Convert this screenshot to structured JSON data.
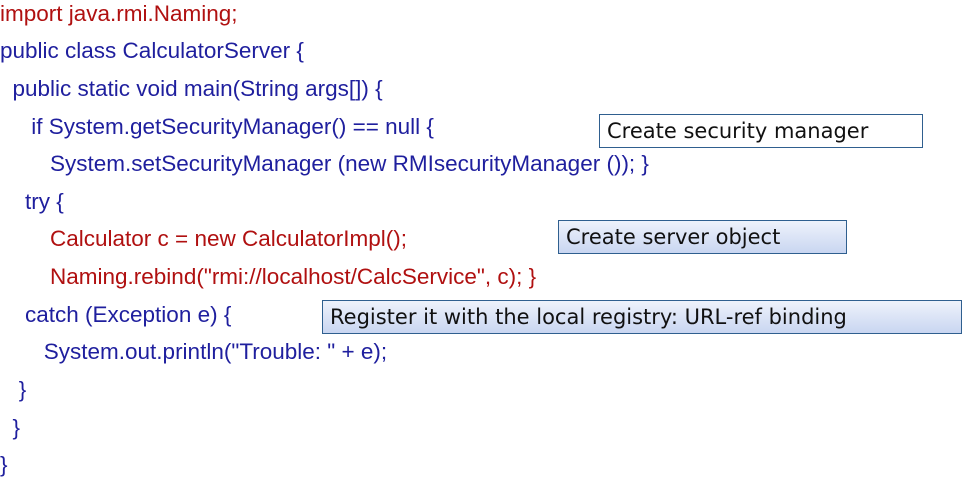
{
  "code_lines": [
    "import java.rmi.Naming;",
    "public class CalculatorServer {",
    "  public static void main(String args[]) {",
    "     if System.getSecurityManager() == null {",
    "        System.setSecurityManager (new RMIsecurityManager ()); }",
    "    try {",
    "        Calculator c = new CalculatorImpl();",
    "        Naming.rebind(\"rmi://localhost/CalcService\", c); }",
    "    catch (Exception e) {",
    "       System.out.println(\"Trouble: \" + e);",
    "   }",
    "  }",
    "}"
  ],
  "callouts": {
    "security": "Create security manager",
    "server_object": "Create server object",
    "register": "Register it with the local registry:  URL-ref binding"
  },
  "colors": {
    "code_blue": "#1f1f9e",
    "code_red": "#b01010",
    "callout_border": "#2f5f8f"
  }
}
